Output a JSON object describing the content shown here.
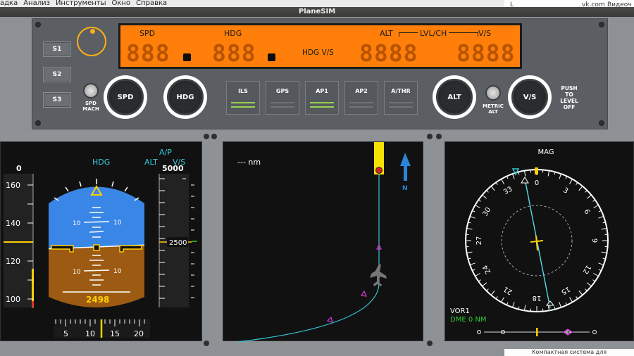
{
  "menu": [
    "адка",
    "Анализ",
    "Инструменты",
    "Окно",
    "Справка"
  ],
  "window_title": "PlaneSIM",
  "background_window": {
    "top_text": "vk.com",
    "top_text2": "Видеоч",
    "bottom_text": "Компактная система для"
  },
  "mcp": {
    "speed_buttons": [
      "S1",
      "S2",
      "S3"
    ],
    "knobs": {
      "spd": "SPD",
      "hdg": "HDG",
      "alt": "ALT",
      "vs": "V/S"
    },
    "spd_mach_label": [
      "SPD",
      "MACH"
    ],
    "metric_alt_label": [
      "METRIC",
      "ALT"
    ],
    "push_label": [
      "PUSH",
      "TO",
      "LEVEL",
      "OFF"
    ],
    "ap_buttons": [
      {
        "label": "ILS",
        "active": true
      },
      {
        "label": "GPS",
        "active": false
      },
      {
        "label": "AP1",
        "active": true
      },
      {
        "label": "AP2",
        "active": false
      },
      {
        "label": "A/THR",
        "active": false
      }
    ],
    "display": {
      "spd_label": "SPD",
      "hdg_label": "HDG",
      "alt_label": "ALT",
      "lvlch_label": "LVL/CH",
      "vs_label": "V/S",
      "hdgvs_label": "HDG V/S",
      "spd_value": "888",
      "hdg_value": "888",
      "alt_value": "8888",
      "vs_value": "8888"
    },
    "colors": {
      "display_bg": "#ff7f0a",
      "ap_active": "#99d24f"
    }
  },
  "pfd": {
    "speed_readout": "0",
    "fma": {
      "ap": "A/P",
      "hdg": "HDG",
      "alt": "ALT",
      "vs": "V/S"
    },
    "alt_target": "5000",
    "speed_ticks": [
      "160",
      "140",
      "120",
      "100"
    ],
    "pitch_ticks": [
      "10",
      "10",
      "10",
      "10"
    ],
    "altitude_bug": "2500",
    "radio_alt": "2498",
    "scale_ticks": [
      "5",
      "10",
      "15",
      "20"
    ],
    "colors": {
      "sky": "#3a86e6",
      "ground": "#9c5a12"
    }
  },
  "nd": {
    "distance": "--- nm",
    "north_label": "N"
  },
  "hsi": {
    "title": "MAG",
    "compass": [
      "0",
      "3",
      "6",
      "9",
      "12",
      "15",
      "18",
      "21",
      "24",
      "27",
      "30",
      "33"
    ],
    "vor": "VOR1",
    "dme": "DME 0 NM",
    "colors": {
      "dme": "#33cc33",
      "cyan": "#37c7d8"
    }
  }
}
